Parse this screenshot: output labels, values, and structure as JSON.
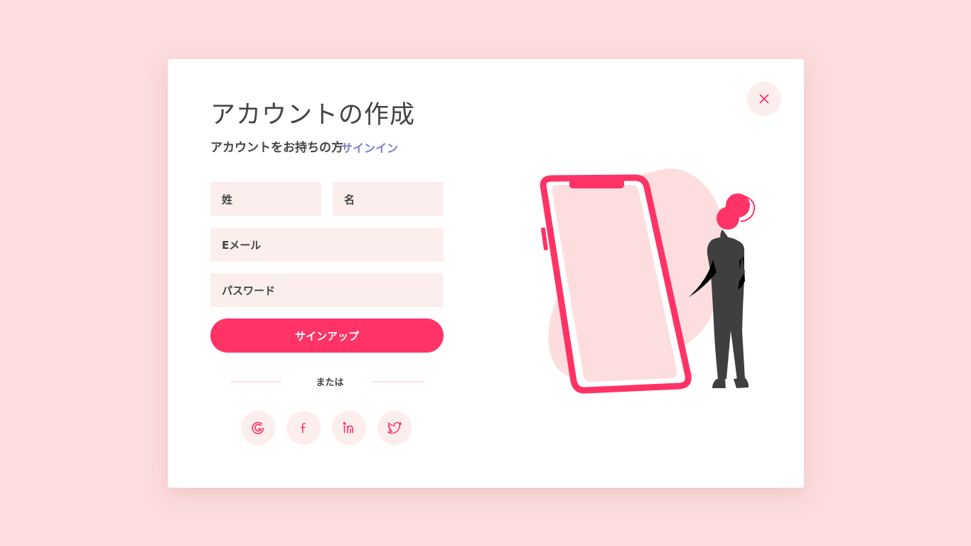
{
  "modal": {
    "title": "アカウントの作成",
    "subtitle": "アカウントをお持ちの方",
    "signin_link": "サインイン"
  },
  "form": {
    "last_name_placeholder": "姓",
    "first_name_placeholder": "名",
    "email_placeholder": "Eメール",
    "password_placeholder": "パスワード",
    "submit_label": "サインアップ"
  },
  "divider": {
    "label": "または"
  },
  "social": {
    "items": [
      {
        "name": "google-icon"
      },
      {
        "name": "facebook-icon"
      },
      {
        "name": "linkedin-icon"
      },
      {
        "name": "twitter-icon"
      }
    ]
  },
  "icons": {
    "close": "close-icon"
  },
  "colors": {
    "background": "#fdddde",
    "accent": "#ff3366",
    "field_bg": "#fdeeee",
    "link": "#7b7bd6",
    "text": "#444444"
  }
}
